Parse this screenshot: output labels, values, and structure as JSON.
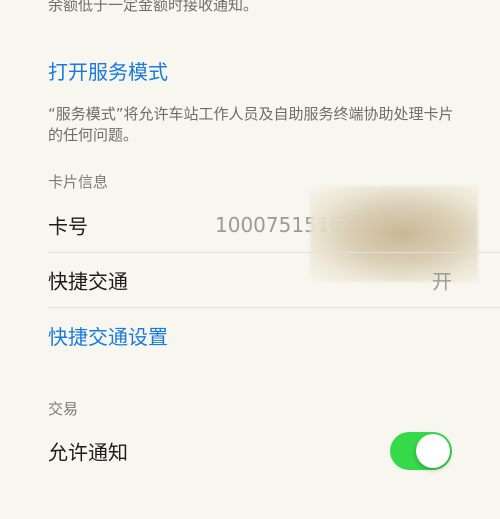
{
  "notice_text": "余额低于一定金额时接收通知。",
  "service_mode": {
    "link_label": "打开服务模式",
    "description": "“服务模式”将允许车站工作人员及自助服务终端协助处理卡片的任何问题。"
  },
  "card_info": {
    "header": "卡片信息",
    "card_number_label": "卡号",
    "card_number_value": "1000751516",
    "express_transit_label": "快捷交通",
    "express_transit_value": "开",
    "express_transit_settings_label": "快捷交通设置"
  },
  "transactions": {
    "header": "交易",
    "allow_notifications_label": "允许通知",
    "allow_notifications_on": true
  },
  "colors": {
    "link": "#1a7ae0",
    "toggle_on": "#35d94a",
    "background": "#f7f6ef"
  }
}
